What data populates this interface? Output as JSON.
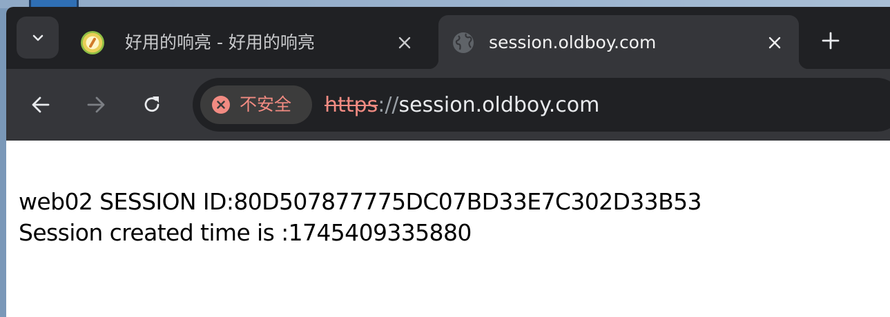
{
  "browser": {
    "tabs": [
      {
        "title": "好用的响亮 - 好用的响亮",
        "icon": "app-favicon-icon",
        "active": false
      },
      {
        "title": "session.oldboy.com",
        "icon": "globe-icon",
        "active": true
      }
    ],
    "address_bar": {
      "security_label": "不安全",
      "url_scheme": "https",
      "url_separator": "://",
      "url_host": "session.oldboy.com"
    },
    "colors": {
      "tabstrip": "#202124",
      "toolbar": "#35363a",
      "warning": "#f28b82"
    }
  },
  "page": {
    "line1": "web02 SESSION ID:80D507877775DC07BD33E7C302D33B53",
    "line2": "Session created time is :1745409335880"
  }
}
